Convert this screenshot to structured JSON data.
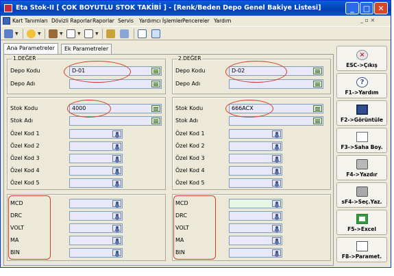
{
  "window": {
    "title": "Eta Stok-II  [ ÇOK BOYUTLU STOK TAKİBİ ]  - [Renk/Beden Depo Genel Bakiye Listesi]",
    "minimize": "_",
    "maximize": "□",
    "close": "✕"
  },
  "menu": {
    "items": [
      "Kart Tanımları",
      "Dövizli Raporlar",
      "Raporlar",
      "Servis",
      "Yardımcı İşlemler",
      "Pencereler",
      "Yardım"
    ],
    "mdi_controls": "_ ▫ ×"
  },
  "toolbar": {
    "icons": [
      "save-icon",
      "help-icon",
      "tools-icon",
      "window-icon",
      "layout-icon",
      "print-icon",
      "grid-icon",
      "table-icon",
      "refresh-icon"
    ]
  },
  "tabs": [
    {
      "label": "Ana Parametreler",
      "active": true
    },
    {
      "label": "Ek Parametreler",
      "active": false
    }
  ],
  "first": {
    "legend": "1.DEĞER",
    "depo_kodu_label": "Depo Kodu",
    "depo_kodu_value": "D-01",
    "depo_adi_label": "Depo Adı",
    "depo_adi_value": "",
    "stok_kodu_label": "Stok Kodu",
    "stok_kodu_value": "4000",
    "stok_adi_label": "Stok Adı",
    "stok_adi_value": "",
    "ozel_kod_labels": [
      "Özel Kod 1",
      "Özel Kod 2",
      "Özel Kod 3",
      "Özel Kod 4",
      "Özel Kod 5"
    ],
    "attr_labels": [
      "MCD",
      "DRC",
      "VOLT",
      "MA",
      "BIN"
    ]
  },
  "second": {
    "legend": "2.DEĞER",
    "depo_kodu_label": "Depo Kodu",
    "depo_kodu_value": "D-02",
    "depo_adi_label": "Depo Adı",
    "depo_adi_value": "",
    "stok_kodu_label": "Stok Kodu",
    "stok_kodu_value": "666ACX",
    "stok_adi_label": "Stok Adı",
    "stok_adi_value": "",
    "ozel_kod_labels": [
      "Özel Kod 1",
      "Özel Kod 2",
      "Özel Kod 3",
      "Özel Kod 4",
      "Özel Kod 5"
    ],
    "attr_labels": [
      "MCD",
      "DRC",
      "VOLT",
      "MA",
      "BIN"
    ]
  },
  "side_buttons": [
    {
      "label": "ESC->Çıkış",
      "icon": "exit-icon"
    },
    {
      "label": "F1->Yardım",
      "icon": "help-icon"
    },
    {
      "label": "F2->Görüntüle",
      "icon": "monitor-icon"
    },
    {
      "label": "F3->Saha Boy.",
      "icon": "field-size-icon"
    },
    {
      "label": "F4->Yazdır",
      "icon": "printer-icon"
    },
    {
      "label": "sF4->Seç.Yaz.",
      "icon": "select-print-icon"
    },
    {
      "label": "F5->Excel",
      "icon": "excel-icon"
    },
    {
      "label": "F8->Paramet.",
      "icon": "parameters-icon"
    }
  ],
  "colors": {
    "title_bar": "#0a5fd8",
    "window_bg": "#ece9d8",
    "highlight": "#d23a2a",
    "field_lavender": "#e8e8f8"
  }
}
